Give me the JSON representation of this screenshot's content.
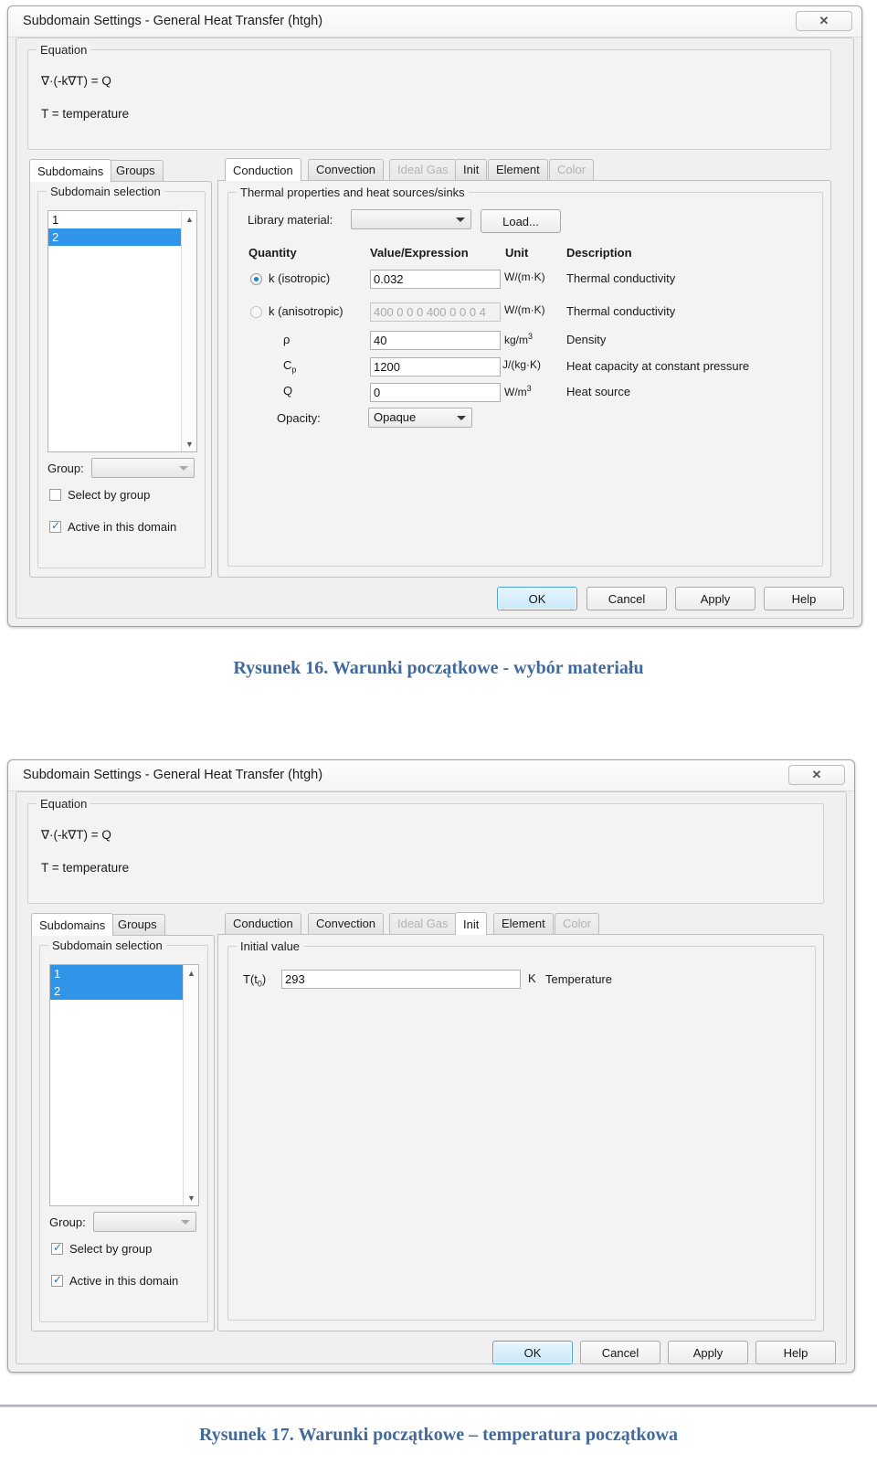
{
  "page": {
    "caption_1": "Rysunek 16. Warunki początkowe - wybór materiału",
    "caption_2": "Rysunek 17. Warunki początkowe – temperatura początkowa",
    "caption_color": "#41699c"
  },
  "dialog1": {
    "title": "Subdomain Settings - General Heat Transfer (htgh)",
    "close_label": "✕",
    "equation": {
      "legend": "Equation",
      "line1": "∇·(-k∇T) = Q",
      "line2": "T = temperature"
    },
    "left_tabs": [
      {
        "label": "Subdomains",
        "active": true,
        "disabled": false
      },
      {
        "label": "Groups",
        "active": false,
        "disabled": false
      }
    ],
    "selection": {
      "legend": "Subdomain selection",
      "items": [
        {
          "label": "1",
          "selected": false
        },
        {
          "label": "2",
          "selected": true
        }
      ],
      "group_label": "Group:",
      "group_value": "",
      "select_by_group": {
        "label": "Select by group",
        "checked": false
      },
      "active_in_domain": {
        "label": "Active in this domain",
        "checked": true
      }
    },
    "right_tabs": [
      {
        "label": "Conduction",
        "active": true,
        "disabled": false
      },
      {
        "label": "Convection",
        "active": false,
        "disabled": false
      },
      {
        "label": "Ideal Gas",
        "active": false,
        "disabled": true
      },
      {
        "label": "Init",
        "active": false,
        "disabled": false
      },
      {
        "label": "Element",
        "active": false,
        "disabled": false
      },
      {
        "label": "Color",
        "active": false,
        "disabled": true
      }
    ],
    "properties": {
      "legend": "Thermal properties and heat sources/sinks",
      "library_label": "Library material:",
      "library_value": "",
      "load_button": "Load...",
      "headers": {
        "quantity": "Quantity",
        "value": "Value/Expression",
        "unit": "Unit",
        "description": "Description"
      },
      "rows": [
        {
          "control": "radio",
          "checked": true,
          "quantity": "k (isotropic)",
          "value": "0.032",
          "disabled": false,
          "unit_html": "W/(m·K)",
          "description": "Thermal conductivity"
        },
        {
          "control": "radio",
          "checked": false,
          "quantity": "k (anisotropic)",
          "value": "400 0 0 0 400 0 0 0 4",
          "disabled": true,
          "unit_html": "W/(m·K)",
          "description": "Thermal conductivity"
        },
        {
          "control": "none",
          "quantity": "ρ",
          "value": "40",
          "disabled": false,
          "unit_html": "kg/m3",
          "description": "Density"
        },
        {
          "control": "none",
          "quantity": "Cp",
          "value": "1200",
          "disabled": false,
          "unit_html": "J/(kg·K)",
          "description": "Heat capacity at constant pressure"
        },
        {
          "control": "none",
          "quantity": "Q",
          "value": "0",
          "disabled": false,
          "unit_html": "W/m3",
          "description": "Heat source"
        }
      ],
      "opacity_label": "Opacity:",
      "opacity_value": "Opaque"
    },
    "buttons": {
      "ok": "OK",
      "cancel": "Cancel",
      "apply": "Apply",
      "help": "Help"
    }
  },
  "dialog2": {
    "title": "Subdomain Settings - General Heat Transfer (htgh)",
    "close_label": "✕",
    "equation": {
      "legend": "Equation",
      "line1": "∇·(-k∇T) = Q",
      "line2": "T = temperature"
    },
    "left_tabs": [
      {
        "label": "Subdomains",
        "active": true,
        "disabled": false
      },
      {
        "label": "Groups",
        "active": false,
        "disabled": false
      }
    ],
    "selection": {
      "legend": "Subdomain selection",
      "items": [
        {
          "label": "1",
          "selected": true
        },
        {
          "label": "2",
          "selected": true
        }
      ],
      "group_label": "Group:",
      "group_value": "",
      "select_by_group": {
        "label": "Select by group",
        "checked": true
      },
      "active_in_domain": {
        "label": "Active in this domain",
        "checked": true
      }
    },
    "right_tabs": [
      {
        "label": "Conduction",
        "active": false,
        "disabled": false
      },
      {
        "label": "Convection",
        "active": false,
        "disabled": false
      },
      {
        "label": "Ideal Gas",
        "active": false,
        "disabled": true
      },
      {
        "label": "Init",
        "active": true,
        "disabled": false
      },
      {
        "label": "Element",
        "active": false,
        "disabled": false
      },
      {
        "label": "Color",
        "active": false,
        "disabled": true
      }
    ],
    "initial_value": {
      "legend": "Initial value",
      "quantity": "T(t0)",
      "value": "293",
      "unit": "K",
      "description": "Temperature"
    },
    "buttons": {
      "ok": "OK",
      "cancel": "Cancel",
      "apply": "Apply",
      "help": "Help"
    }
  }
}
